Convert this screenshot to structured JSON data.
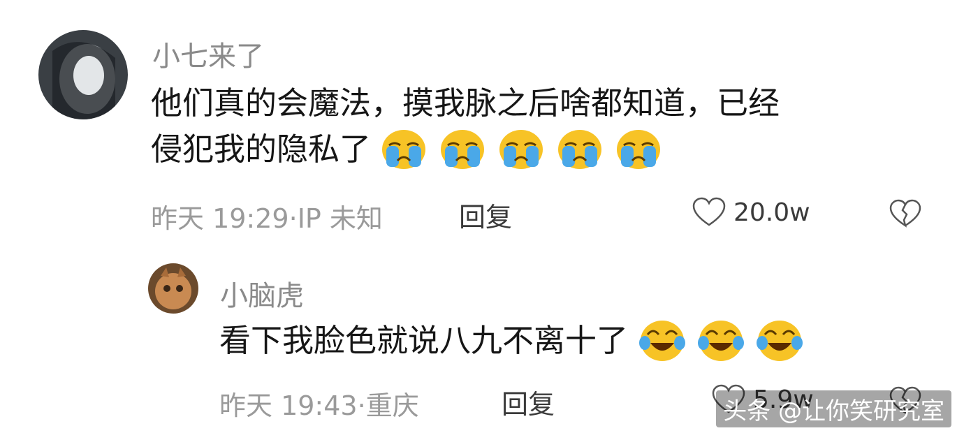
{
  "comments": [
    {
      "username": "小七来了",
      "text_line1": "他们真的会魔法，摸我脉之后啥都知道，已经",
      "text_line2": "侵犯我的隐私了",
      "emojis": [
        "crying-face",
        "crying-face",
        "crying-face",
        "crying-face",
        "crying-face"
      ],
      "time": "昨天 19:29",
      "ip": "IP 未知",
      "reply_label": "回复",
      "likes": "20.0w"
    },
    {
      "username": "小脑虎",
      "text_line1": "看下我脸色就说八九不离十了",
      "emojis": [
        "tears-of-joy-face",
        "tears-of-joy-face",
        "tears-of-joy-face"
      ],
      "time": "昨天 19:43",
      "location": "重庆",
      "reply_label": "回复",
      "likes": "5.9w"
    }
  ],
  "watermark": "头条 @让你笑研究室",
  "colors": {
    "username": "#8a8a8a",
    "text": "#161616",
    "meta": "#9a9a9a",
    "emoji": "#f7c326",
    "tear": "#4aa8e8"
  }
}
